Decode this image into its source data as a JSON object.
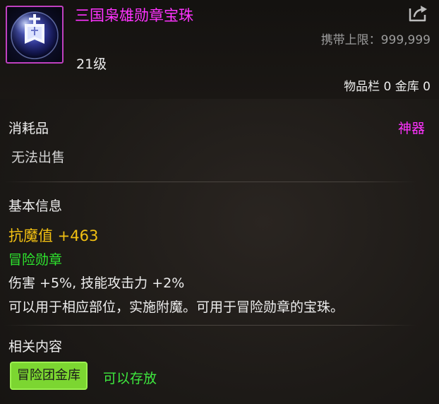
{
  "item": {
    "name": "三国枭雄勋章宝珠",
    "level": "21级",
    "carry_limit": "携带上限：999,999",
    "storage_counts": "物品栏 0 金库 0",
    "category": "消耗品",
    "rarity": "神器",
    "sell_status": "无法出售"
  },
  "basic_info": {
    "heading": "基本信息",
    "magic_resist": "抗魔值 +463",
    "medal_type": "冒险勋章",
    "effect": "伤害 +5%, 技能攻击力 +2%",
    "description": "可以用于相应部位，实施附魔。可用于冒险勋章的宝珠。"
  },
  "related": {
    "heading": "相关内容",
    "bank_label": "冒险团金库",
    "bank_status": "可以存放"
  },
  "colors": {
    "name": "#ff33ff",
    "rarity": "#ff33ff",
    "magic_resist": "#f2c012",
    "medal_type": "#2ee62e",
    "bank_badge_bg": "#7cd631",
    "icon_border": "#c040c0"
  },
  "icons": {
    "item_icon": "orb-banner-icon",
    "share_icon": "share-arrow-icon"
  }
}
